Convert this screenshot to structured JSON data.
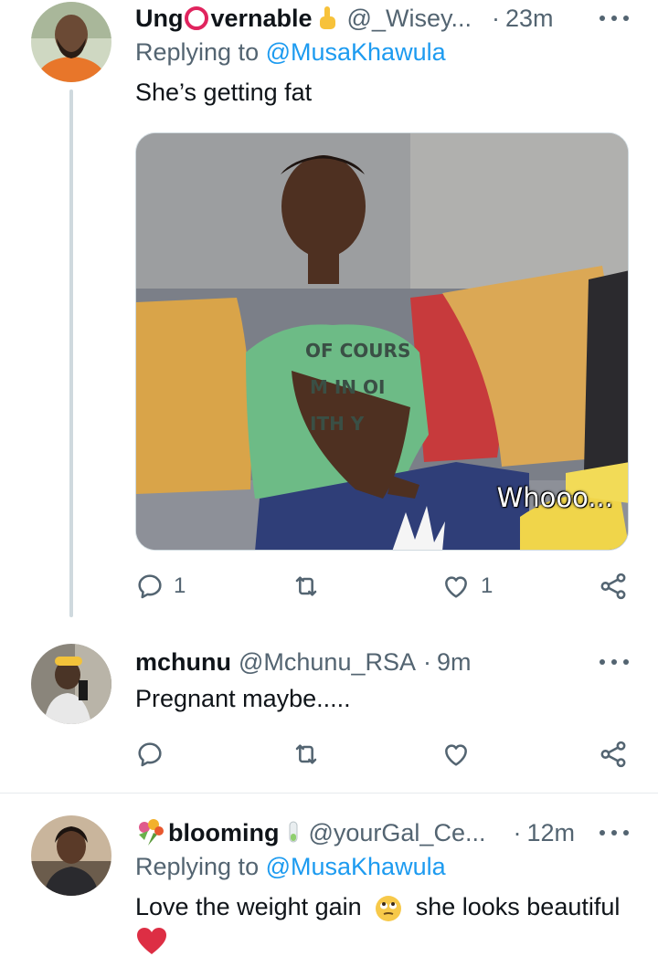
{
  "tweets": [
    {
      "display_name": "UngOvernable",
      "name_prefix": "Ung",
      "name_suffix": "vernable",
      "handle": "@_Wisey...",
      "separator": "·",
      "time": "23m",
      "replying_label": "Replying to ",
      "replying_to": "@MusaKhawula",
      "text": "She’s getting fat",
      "media_caption": "Whooo...",
      "reply_count": "1",
      "retweet_count": "",
      "like_count": "1"
    },
    {
      "display_name": "mchunu",
      "handle": "@Mchunu_RSA",
      "separator": "·",
      "time": "9m",
      "text": "Pregnant maybe....."
    },
    {
      "display_name": "blooming",
      "handle": "@yourGal_Ce...",
      "separator": "·",
      "time": "12m",
      "replying_label": "Replying to ",
      "replying_to": "@MusaKhawula",
      "text_before": "Love the weight gain",
      "text_after": "she looks beautiful"
    }
  ],
  "colors": {
    "link": "#1d9bf0",
    "secondary_text": "#536471",
    "heart": "#e0245e"
  },
  "icons": [
    "reply-icon",
    "retweet-icon",
    "like-icon",
    "share-icon",
    "more-icon",
    "pointing-hand-emoji",
    "bouquet-emoji",
    "eye-roll-emoji",
    "red-heart-emoji"
  ]
}
